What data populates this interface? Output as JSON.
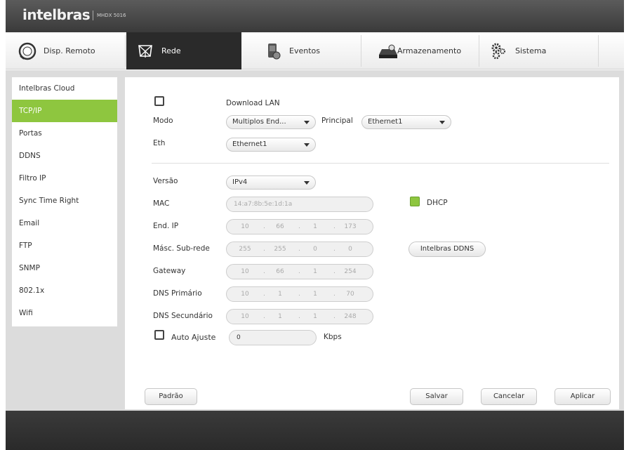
{
  "brand": {
    "logo": "intelbras",
    "model": "MHDX 5016"
  },
  "tabs": [
    {
      "label": "Disp. Remoto",
      "icon": "remote-device-icon",
      "active": false
    },
    {
      "label": "Rede",
      "icon": "network-icon",
      "active": true
    },
    {
      "label": "Eventos",
      "icon": "events-icon",
      "active": false
    },
    {
      "label": "Armazenamento",
      "icon": "storage-icon",
      "active": false
    },
    {
      "label": "Sistema",
      "icon": "gears-icon",
      "active": false
    }
  ],
  "sidebar": {
    "items": [
      {
        "label": "Intelbras Cloud",
        "active": false
      },
      {
        "label": "TCP/IP",
        "active": true
      },
      {
        "label": "Portas",
        "active": false
      },
      {
        "label": "DDNS",
        "active": false
      },
      {
        "label": "Filtro IP",
        "active": false
      },
      {
        "label": "Sync Time Right",
        "active": false
      },
      {
        "label": "Email",
        "active": false
      },
      {
        "label": "FTP",
        "active": false
      },
      {
        "label": "SNMP",
        "active": false
      },
      {
        "label": "802.1x",
        "active": false
      },
      {
        "label": "Wifi",
        "active": false
      }
    ]
  },
  "form": {
    "download_lan_label": "Download LAN",
    "download_lan_checked": false,
    "modo_label": "Modo",
    "modo_value": "Multiplos End...",
    "principal_label": "Principal",
    "principal_value": "Ethernet1",
    "eth_label": "Eth",
    "eth_value": "Ethernet1",
    "versao_label": "Versão",
    "versao_value": "IPv4",
    "mac_label": "MAC",
    "mac_value": "14:a7:8b:5e:1d:1a",
    "dhcp_label": "DHCP",
    "dhcp_checked": true,
    "end_ip_label": "End. IP",
    "end_ip": [
      "10",
      "66",
      "1",
      "173"
    ],
    "mask_label": "Másc. Sub-rede",
    "mask": [
      "255",
      "255",
      "0",
      "0"
    ],
    "intelbras_ddns_button": "Intelbras DDNS",
    "gateway_label": "Gateway",
    "gateway": [
      "10",
      "66",
      "1",
      "254"
    ],
    "dns1_label": "DNS Primário",
    "dns1": [
      "10",
      "1",
      "1",
      "70"
    ],
    "dns2_label": "DNS Secundário",
    "dns2": [
      "10",
      "1",
      "1",
      "248"
    ],
    "auto_ajuste_label": "Auto Ajuste",
    "auto_ajuste_checked": false,
    "bandwidth_value": "0",
    "bandwidth_unit": "Kbps"
  },
  "buttons": {
    "padrao": "Padrão",
    "salvar": "Salvar",
    "cancelar": "Cancelar",
    "aplicar": "Aplicar"
  },
  "colors": {
    "accent": "#8ec63f",
    "active_tab": "#2a2a2a",
    "titlebar": "#4a4a4a"
  }
}
